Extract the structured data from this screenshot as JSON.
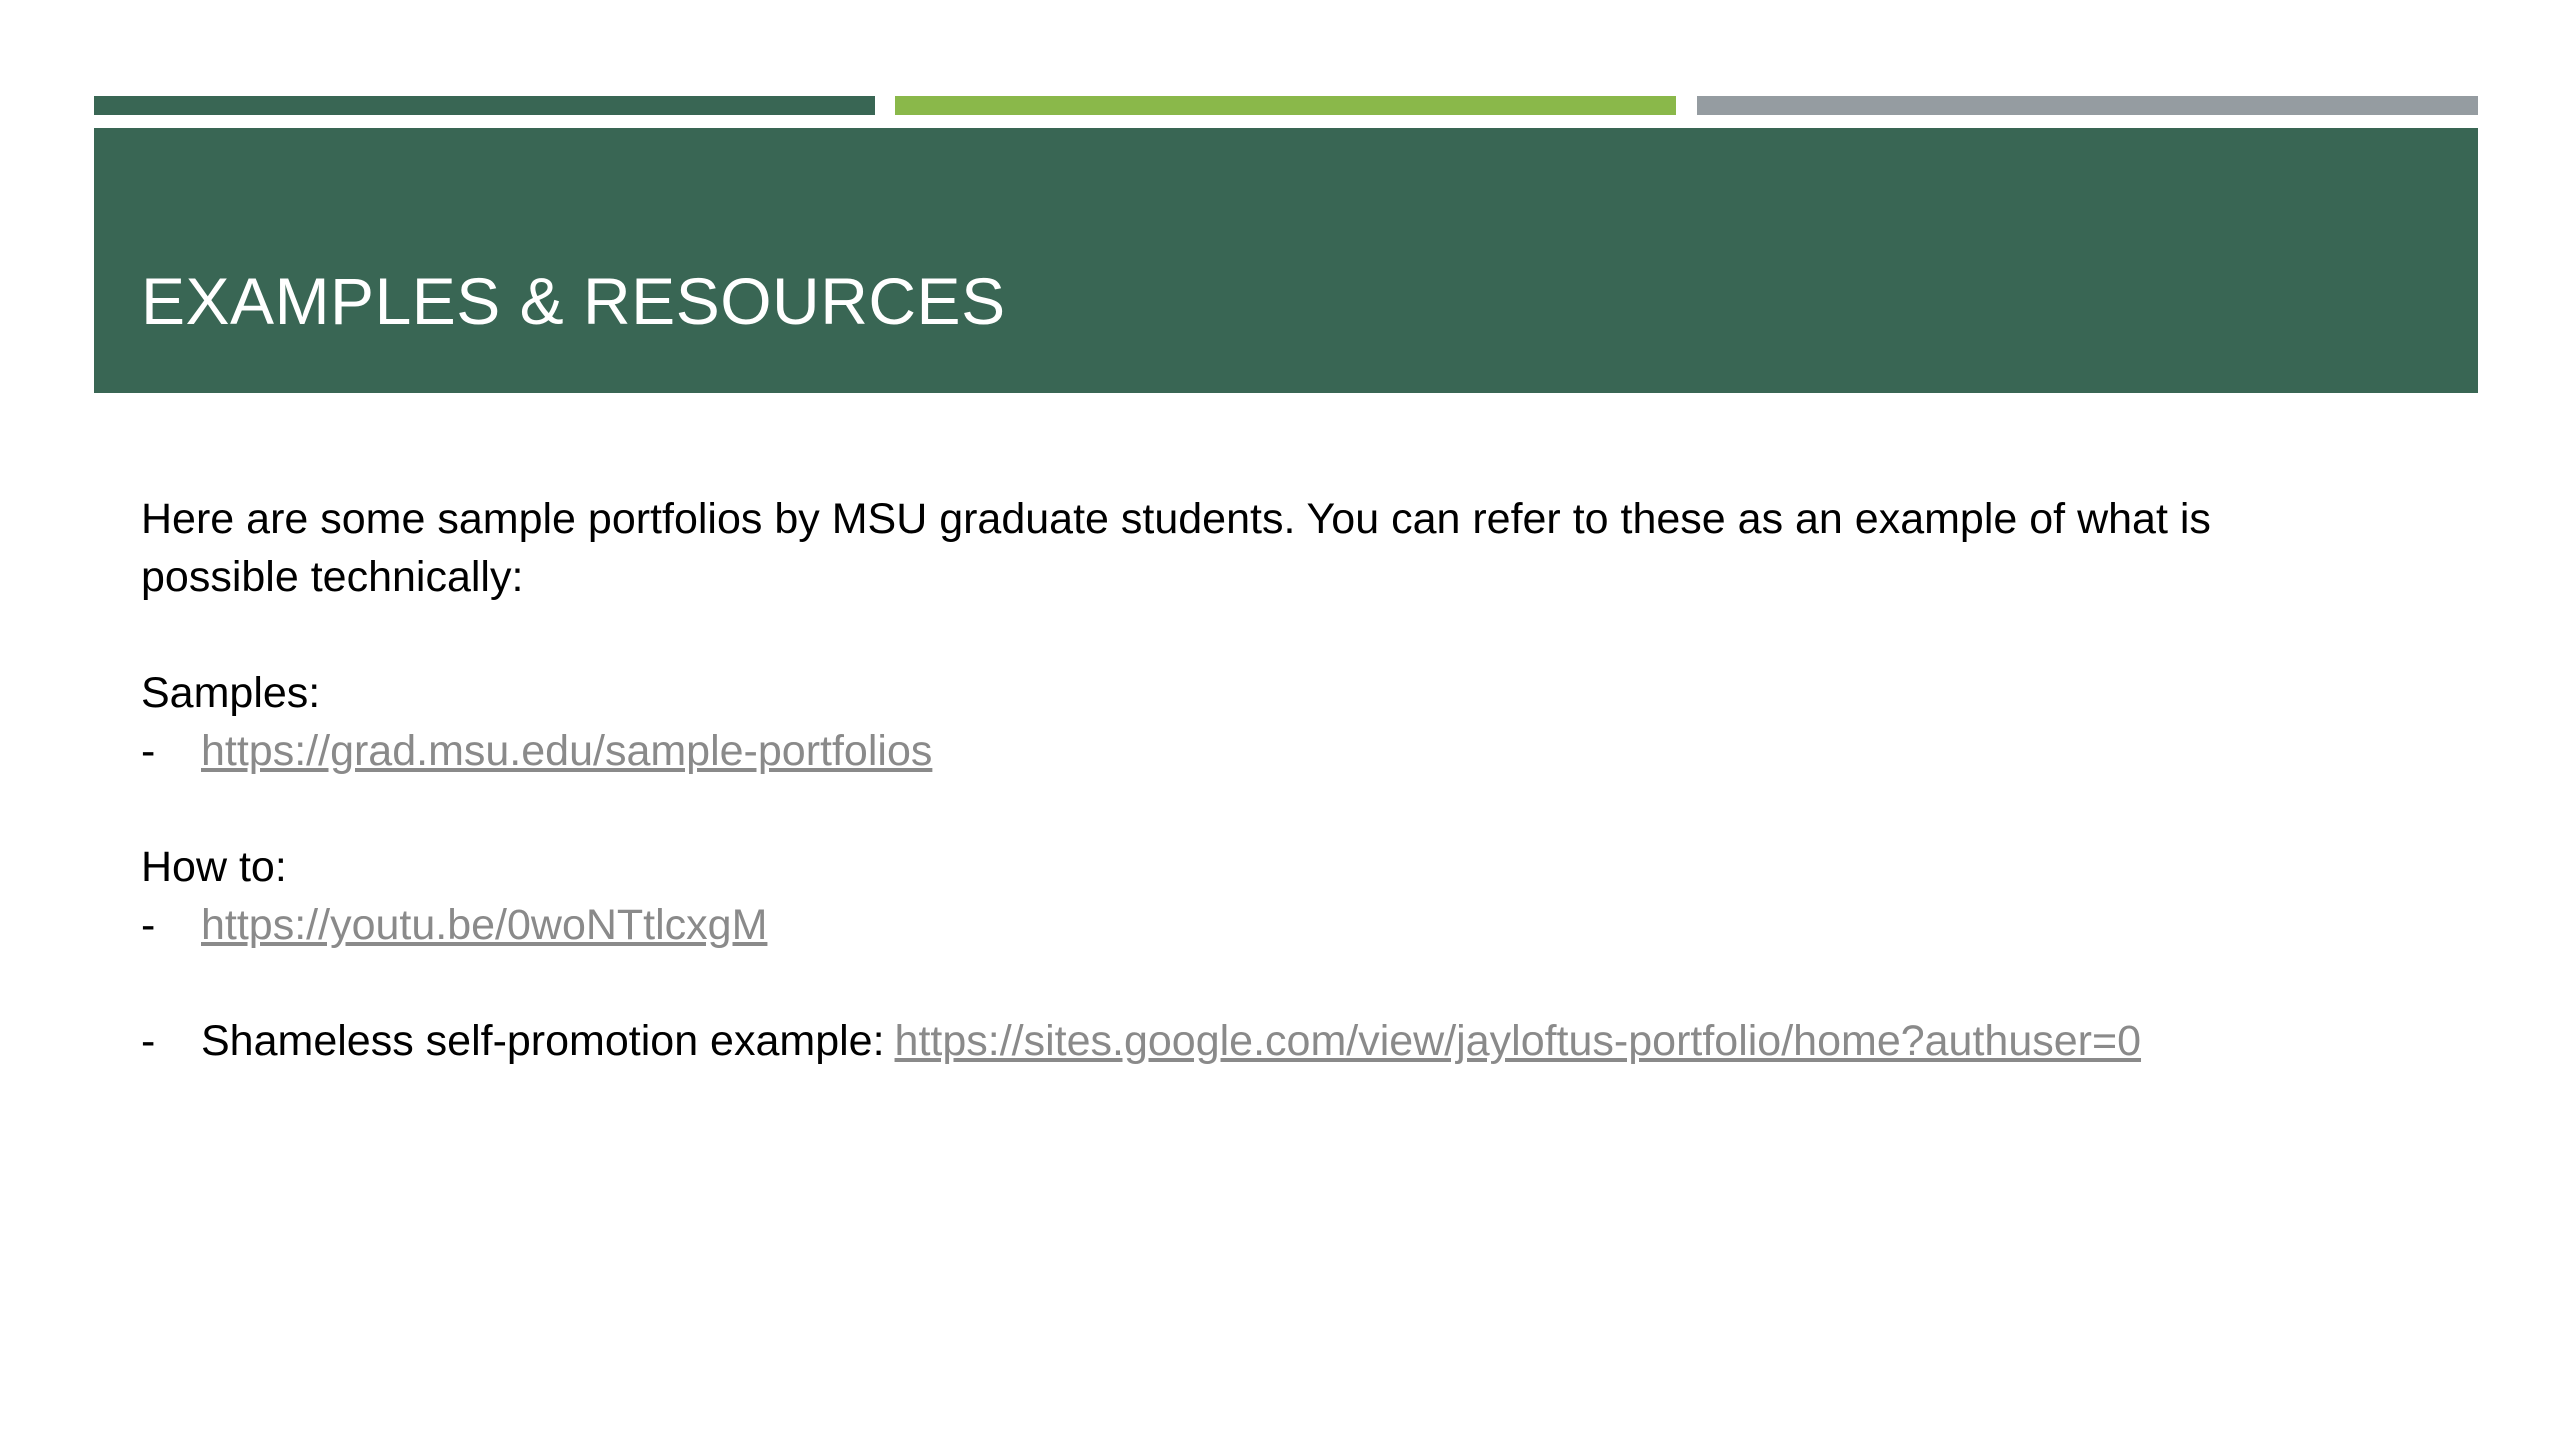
{
  "colors": {
    "accent_dark_green": "#396654",
    "accent_light_green": "#8ab84a",
    "accent_gray": "#959ca1",
    "title_band": "#396654",
    "link_gray": "#8a8a8a"
  },
  "header": {
    "title": "EXAMPLES & RESOURCES"
  },
  "content": {
    "intro": "Here are some sample portfolios by MSU graduate students. You can refer to these as an example of what is possible technically:",
    "samples_heading": "Samples:",
    "samples_dash": "-",
    "samples_link": "https://grad.msu.edu/sample-portfolios",
    "howto_heading": "How to:",
    "howto_dash": "-",
    "howto_link": "https://youtu.be/0woNTtlcxgM",
    "promo_dash": "-",
    "promo_label": "Shameless self-promotion example:",
    "promo_link": "https://sites.google.com/view/jayloftus-portfolio/home?authuser=0"
  }
}
